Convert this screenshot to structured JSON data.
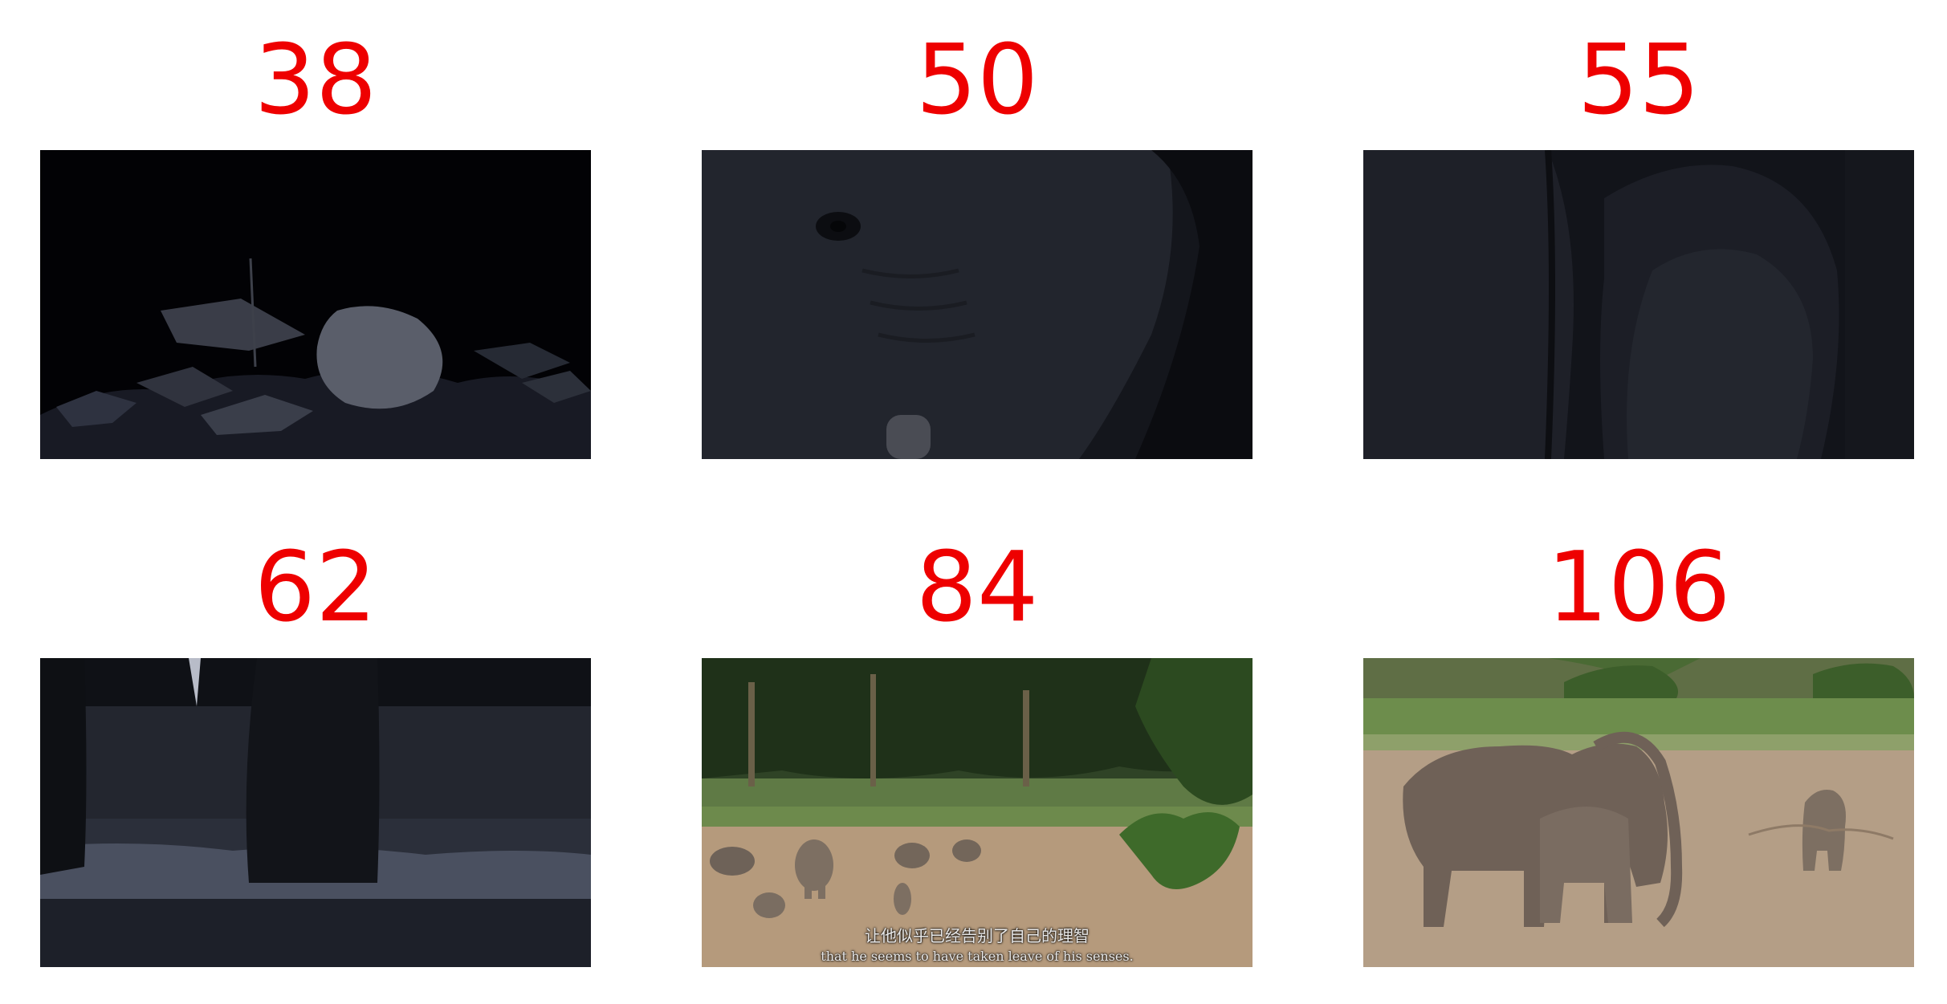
{
  "frames": [
    {
      "label": "38"
    },
    {
      "label": "50"
    },
    {
      "label": "55"
    },
    {
      "label": "62"
    },
    {
      "label": "84",
      "subtitle_cn": "让他似乎已经告别了自己的理智",
      "subtitle_en": "that he seems to have taken leave of his senses."
    },
    {
      "label": "106"
    }
  ],
  "colors": {
    "label": "#ee0000",
    "background": "#ffffff"
  }
}
